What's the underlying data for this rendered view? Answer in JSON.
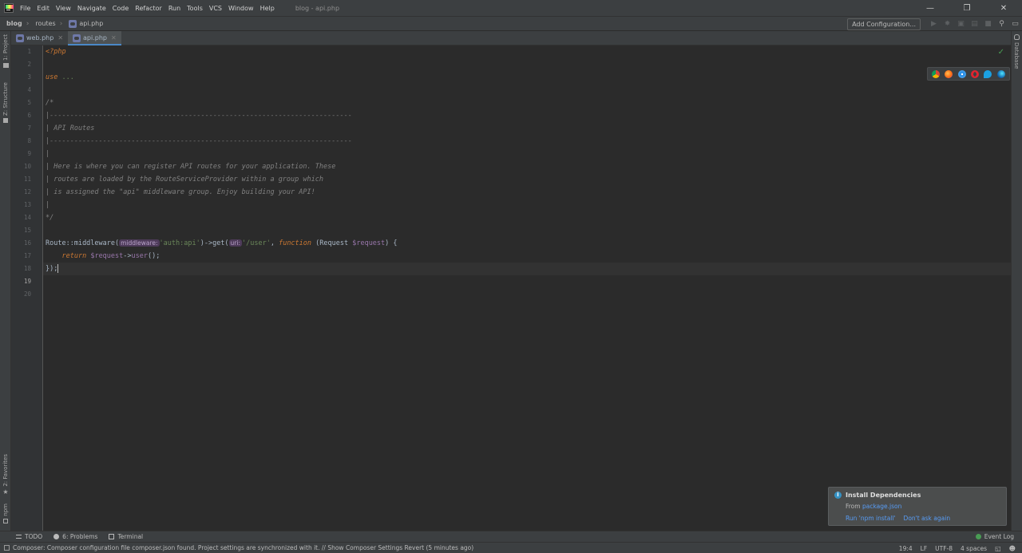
{
  "menubar": {
    "items": [
      "File",
      "Edit",
      "View",
      "Navigate",
      "Code",
      "Refactor",
      "Run",
      "Tools",
      "VCS",
      "Window",
      "Help"
    ],
    "window_title": "blog - api.php"
  },
  "navbar": {
    "project": "blog",
    "folder": "routes",
    "file": "api.php",
    "add_configuration": "Add Configuration..."
  },
  "left_tools": {
    "project": "1: Project",
    "structure": "Z: Structure",
    "favorites": "2: Favorites",
    "npm": "npm"
  },
  "right_tools": {
    "database": "Database"
  },
  "tabs": [
    {
      "label": "web.php",
      "active": false
    },
    {
      "label": "api.php",
      "active": true
    }
  ],
  "editor": {
    "line_numbers": [
      "1",
      "2",
      "3",
      "4",
      "5",
      "6",
      "7",
      "8",
      "9",
      "10",
      "11",
      "12",
      "13",
      "14",
      "15",
      "16",
      "17",
      "18",
      "19",
      "20"
    ],
    "current_line": 19,
    "lines": {
      "l1": "<?php",
      "l3_use": "use",
      "l3_rest": " ...",
      "l6": "/*",
      "l7": "|--------------------------------------------------------------------------",
      "l8": "| API Routes",
      "l9": "|--------------------------------------------------------------------------",
      "l10": "|",
      "l11": "| Here is where you can register API routes for your application. These",
      "l12": "| routes are loaded by the RouteServiceProvider within a group which",
      "l13": "| is assigned the \"api\" middleware group. Enjoy building your API!",
      "l14": "|",
      "l15": "*/",
      "l17_route": "Route",
      "l17_sep": "::middleware(",
      "l17_hint1": "middleware:",
      "l17_str1": "'auth:api'",
      "l17_mid": ")->get(",
      "l17_hint2": "uri:",
      "l17_str2": "'/user'",
      "l17_comma": ", ",
      "l17_function": "function",
      "l17_params_open": " (Request ",
      "l17_var": "$request",
      "l17_params_close": ") {",
      "l18_indent": "    ",
      "l18_return": "return",
      "l18_space": " ",
      "l18_var": "$request",
      "l18_arrow": "->",
      "l18_user": "user",
      "l18_end": "();",
      "l19": "});"
    }
  },
  "bottom_tabs": {
    "todo": "TODO",
    "problems": "6: Problems",
    "terminal": "Terminal",
    "event_log": "Event Log"
  },
  "statusbar": {
    "message": "Composer: Composer configuration file composer.json found. Project settings are synchronized with it. // Show Composer Settings   Revert (5 minutes ago)",
    "position": "19:4",
    "line_sep": "LF",
    "encoding": "UTF-8",
    "indent": "4 spaces"
  },
  "notification": {
    "title": "Install Dependencies",
    "from_label": "From ",
    "from_link": "package.json",
    "action_run": "Run 'npm install'",
    "action_dismiss": "Don't ask again"
  },
  "colors": {
    "accent": "#4a88c7",
    "keyword": "#cc7832",
    "string": "#6a8759",
    "variable": "#9876aa",
    "comment": "#808080",
    "link": "#589df6"
  }
}
